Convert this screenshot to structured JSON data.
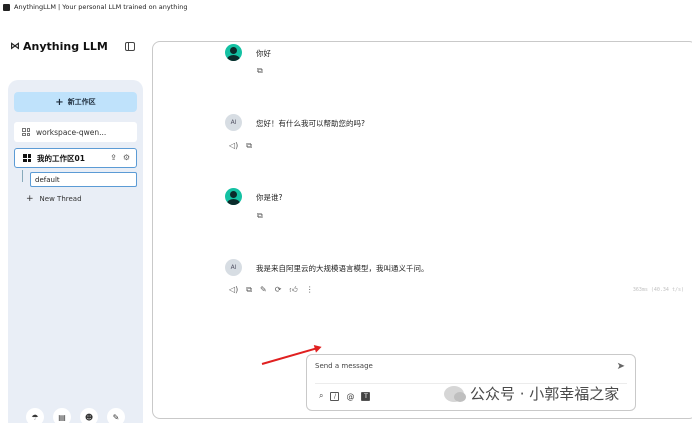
{
  "window": {
    "title": "AnythingLLM | Your personal LLM trained on anything"
  },
  "sidebar": {
    "logo_mark": "⋈",
    "logo_text": "Anything LLM",
    "new_workspace_label": "新工作区",
    "workspaces": [
      {
        "label": "workspace-qwen...",
        "active": false
      },
      {
        "label": "我的工作区01",
        "active": true
      }
    ],
    "threads": [
      {
        "label": "default"
      }
    ],
    "new_thread_label": "New Thread",
    "footer_icons": [
      "community-icon",
      "docs-icon",
      "discord-icon",
      "settings-wrench-icon"
    ]
  },
  "chat": {
    "messages": [
      {
        "role": "user",
        "text": "你好"
      },
      {
        "role": "assistant",
        "text": "您好！有什么我可以帮助您的吗?"
      },
      {
        "role": "user",
        "text": "你是谁?"
      },
      {
        "role": "assistant",
        "text": "我是来自阿里云的大规模语言模型，我叫通义千问。"
      }
    ],
    "assistant_avatar_text": "AI",
    "meta": "363ms (40.34 t/s)"
  },
  "composer": {
    "placeholder": "Send a message"
  },
  "watermark": {
    "text": "公众号 · 小郭幸福之家"
  },
  "colors": {
    "new_workspace_bg": "#bfe2fb",
    "sidebar_panel_bg": "#e9eef6",
    "active_border": "#5b9bd5",
    "user_avatar": "#14c1a3",
    "annotation_arrow": "#e02020"
  }
}
